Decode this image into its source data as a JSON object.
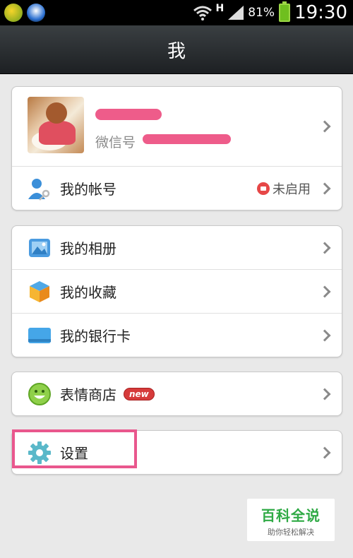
{
  "status_bar": {
    "network": "H",
    "battery_percent": "81%",
    "time": "19:30"
  },
  "header": {
    "title": "我"
  },
  "profile": {
    "wechat_id_label": "微信号"
  },
  "account": {
    "label": "我的帐号",
    "status": "未启用"
  },
  "menu_group_1": [
    {
      "label": "我的相册"
    },
    {
      "label": "我的收藏"
    },
    {
      "label": "我的银行卡"
    }
  ],
  "sticker_store": {
    "label": "表情商店",
    "badge": "new"
  },
  "settings": {
    "label": "设置"
  },
  "watermark": {
    "title": "百科全说",
    "subtitle": "助你轻松解决"
  },
  "colors": {
    "highlight": "#e9578d",
    "badge_red": "#d63b3b",
    "watermark_green": "#2faa45"
  }
}
